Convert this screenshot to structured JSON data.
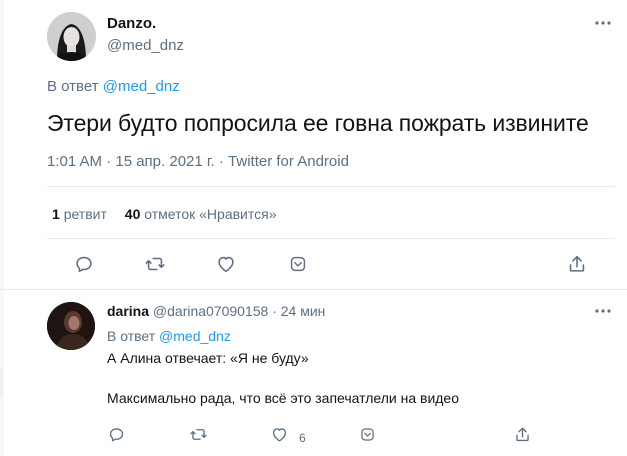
{
  "main_tweet": {
    "author_name": "Danzo.",
    "author_handle": "@med_dnz",
    "reply_prefix": "В ответ",
    "reply_mention": "@med_dnz",
    "text": "Этери будто попросила ее говна пожрать извините",
    "meta": "1:01 AM · 15 апр. 2021 г. · Twitter for Android",
    "retweets_count": "1",
    "retweets_label": "ретвит",
    "likes_count": "40",
    "likes_label": "отметок «Нравится»"
  },
  "reply_tweet": {
    "author_name": "darina",
    "author_handle": "@darina07090158",
    "time": "· 24 мин",
    "reply_prefix": "В ответ",
    "reply_mention": "@med_dnz",
    "text_line1": "А Алина отвечает: «Я не буду»",
    "text_line2": "Максимально рада, что всё это запечатлели на видео",
    "like_count": "6"
  },
  "icons": {
    "action_color": "#5b7083",
    "mention_color": "#1d9bf0"
  }
}
